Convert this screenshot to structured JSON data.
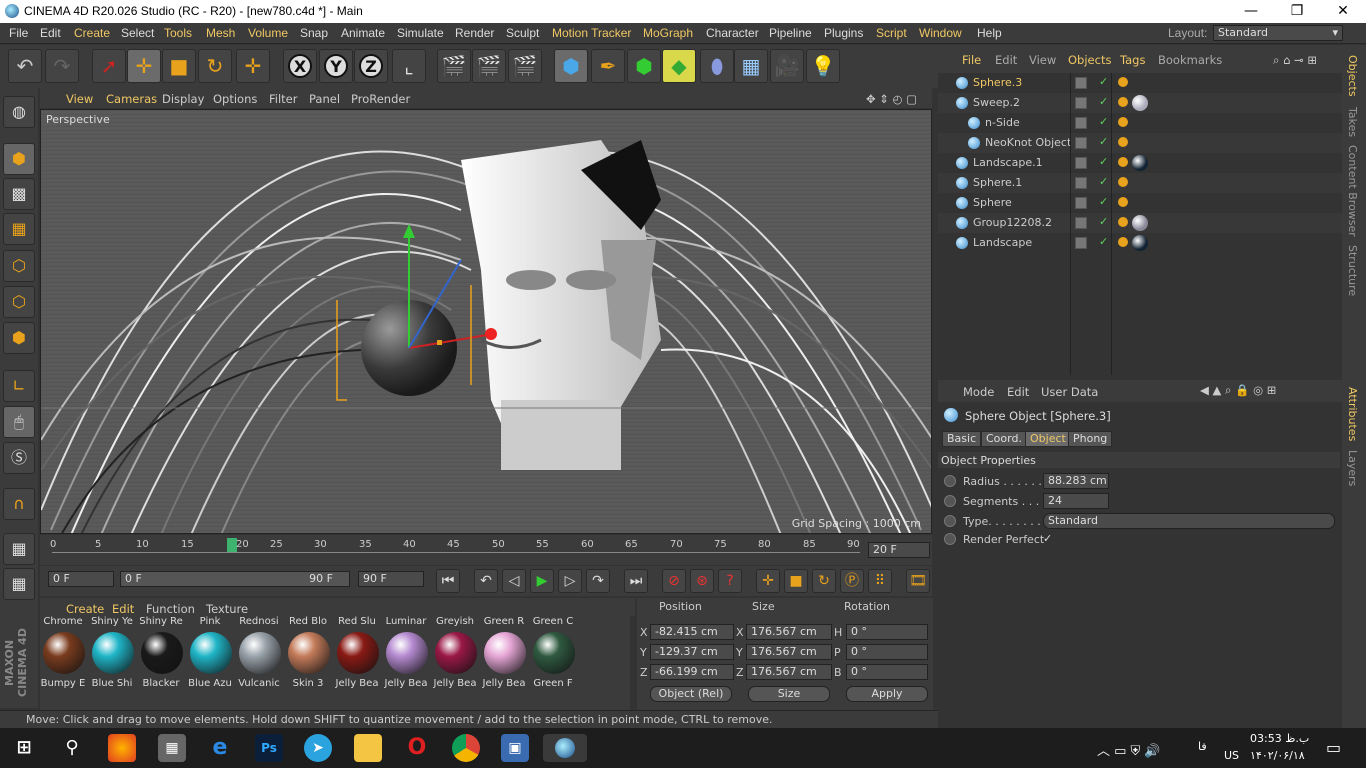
{
  "titlebar": {
    "title": "CINEMA 4D R20.026 Studio (RC - R20) - [new780.c4d *] - Main",
    "minimize": "—",
    "maximize": "❐",
    "close": "✕"
  },
  "menu": {
    "items": [
      "File",
      "Edit",
      "Create",
      "Select",
      "Tools",
      "Mesh",
      "Volume",
      "Snap",
      "Animate",
      "Simulate",
      "Render",
      "Sculpt",
      "Motion Tracker",
      "MoGraph",
      "Character",
      "Pipeline",
      "Plugins",
      "Script",
      "Window",
      "Help"
    ],
    "layout_label": "Layout:",
    "layout_value": "Standard"
  },
  "viewport": {
    "menu": [
      "View",
      "Cameras",
      "Display",
      "Options",
      "Filter",
      "Panel",
      "ProRender"
    ],
    "camera_label": "Perspective",
    "grid_spacing": "Grid Spacing : 1000 cm"
  },
  "timeline": {
    "ticks": [
      "0",
      "5",
      "10",
      "15",
      "20",
      "25",
      "30",
      "35",
      "40",
      "45",
      "50",
      "55",
      "60",
      "65",
      "70",
      "75",
      "80",
      "85",
      "90"
    ],
    "current_frame": "20 F"
  },
  "transport": {
    "start": "0 F",
    "range_start": "0 F",
    "range_end": "90 F",
    "end": "90 F"
  },
  "materials": {
    "menu": [
      "Create",
      "Edit",
      "Function",
      "Texture"
    ],
    "items": [
      {
        "name": "Chrome",
        "color": "#7a3c1e"
      },
      {
        "name": "Shiny Ye",
        "color": "#1fb5c7"
      },
      {
        "name": "Shiny Re",
        "color": "#1a1a1a"
      },
      {
        "name": "Pink",
        "color": "#1fb5c7"
      },
      {
        "name": "Rednosi",
        "color": "#9aa3ab"
      },
      {
        "name": "Red Blo",
        "color": "#c47b5a"
      },
      {
        "name": "Red Slu",
        "color": "#8a1a14"
      },
      {
        "name": "Luminar",
        "color": "#b58ad0"
      },
      {
        "name": "Greyish",
        "color": "#9a1846"
      },
      {
        "name": "Green R",
        "color": "#e6a6d6"
      },
      {
        "name": "Green C",
        "color": "#2f5a40"
      }
    ],
    "bottom_names": [
      "Bumpy E",
      "Blue Shi",
      "Blacker",
      "Blue Azu",
      "Vulcanic",
      "Skin 3",
      "Jelly Bea",
      "Jelly Bea",
      "Jelly Bea",
      "Jelly Bea",
      "Green F"
    ]
  },
  "coords": {
    "headers": [
      "Position",
      "Size",
      "Rotation"
    ],
    "rows": [
      {
        "axis": "X",
        "pos": "-82.415 cm",
        "size_axis": "X",
        "size": "176.567 cm",
        "rot_axis": "H",
        "rot": "0 °"
      },
      {
        "axis": "Y",
        "pos": "-129.37 cm",
        "size_axis": "Y",
        "size": "176.567 cm",
        "rot_axis": "P",
        "rot": "0 °"
      },
      {
        "axis": "Z",
        "pos": "-66.199 cm",
        "size_axis": "Z",
        "size": "176.567 cm",
        "rot_axis": "B",
        "rot": "0 °"
      }
    ],
    "mode": "Object (Rel)",
    "size_mode": "Size",
    "apply": "Apply"
  },
  "status": "Move: Click and drag to move elements. Hold down SHIFT to quantize movement / add to the selection in point mode, CTRL to remove.",
  "objects": {
    "menu": [
      "File",
      "Edit",
      "View",
      "Objects",
      "Tags",
      "Bookmarks"
    ],
    "rows": [
      {
        "name": "Sphere.3",
        "indent": 0,
        "selected": true,
        "mat": ""
      },
      {
        "name": "Sweep.2",
        "indent": 0,
        "selected": false,
        "mat": "#aab"
      },
      {
        "name": "n-Side",
        "indent": 1,
        "selected": false,
        "mat": ""
      },
      {
        "name": "NeoKnot Object",
        "indent": 1,
        "selected": false,
        "mat": ""
      },
      {
        "name": "Landscape.1",
        "indent": 0,
        "selected": false,
        "mat": "#123"
      },
      {
        "name": "Sphere.1",
        "indent": 0,
        "selected": false,
        "mat": ""
      },
      {
        "name": "Sphere",
        "indent": 0,
        "selected": false,
        "mat": ""
      },
      {
        "name": "Group12208.2",
        "indent": 0,
        "selected": false,
        "mat": "#889"
      },
      {
        "name": "Landscape",
        "indent": 0,
        "selected": false,
        "mat": "#123"
      }
    ]
  },
  "attributes": {
    "menu": [
      "Mode",
      "Edit",
      "User Data"
    ],
    "object_title": "Sphere Object [Sphere.3]",
    "tabs": [
      "Basic",
      "Coord.",
      "Object",
      "Phong"
    ],
    "section": "Object Properties",
    "props": [
      {
        "label": "Radius . . . . . .",
        "value": "88.283 cm"
      },
      {
        "label": "Segments . . . .",
        "value": "24"
      },
      {
        "label": "Type. . . . . . . . .",
        "value": "Standard"
      },
      {
        "label": "Render Perfect",
        "value": "✓"
      }
    ]
  },
  "sidetabs": [
    "Objects",
    "Takes",
    "Content Browser",
    "Structure",
    "Attributes",
    "Layers"
  ],
  "taskbar": {
    "time": "03:53 ب.ظ",
    "date": "۱۴۰۲/۰۶/۱۸",
    "lang": "فا",
    "kbd": "US"
  }
}
